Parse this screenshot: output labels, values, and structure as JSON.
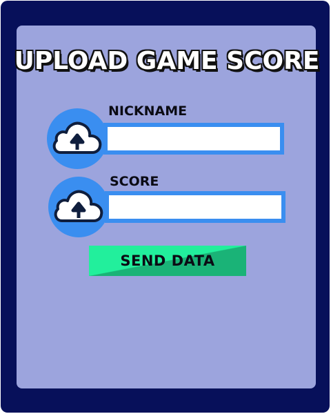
{
  "title": "UPLOAD GAME SCORE",
  "fields": [
    {
      "label": "NICKNAME",
      "value": "",
      "icon": "cloud-upload-icon"
    },
    {
      "label": "SCORE",
      "value": "",
      "icon": "cloud-upload-icon"
    }
  ],
  "send_button": {
    "label": "SEND DATA"
  },
  "colors": {
    "frame": "#07105a",
    "panel": "#9ca4dd",
    "accent_blue": "#3a8ef0",
    "button_light": "#22ef9c",
    "button_dark": "#1ab377",
    "cloud_outline": "#0f1e3d"
  }
}
